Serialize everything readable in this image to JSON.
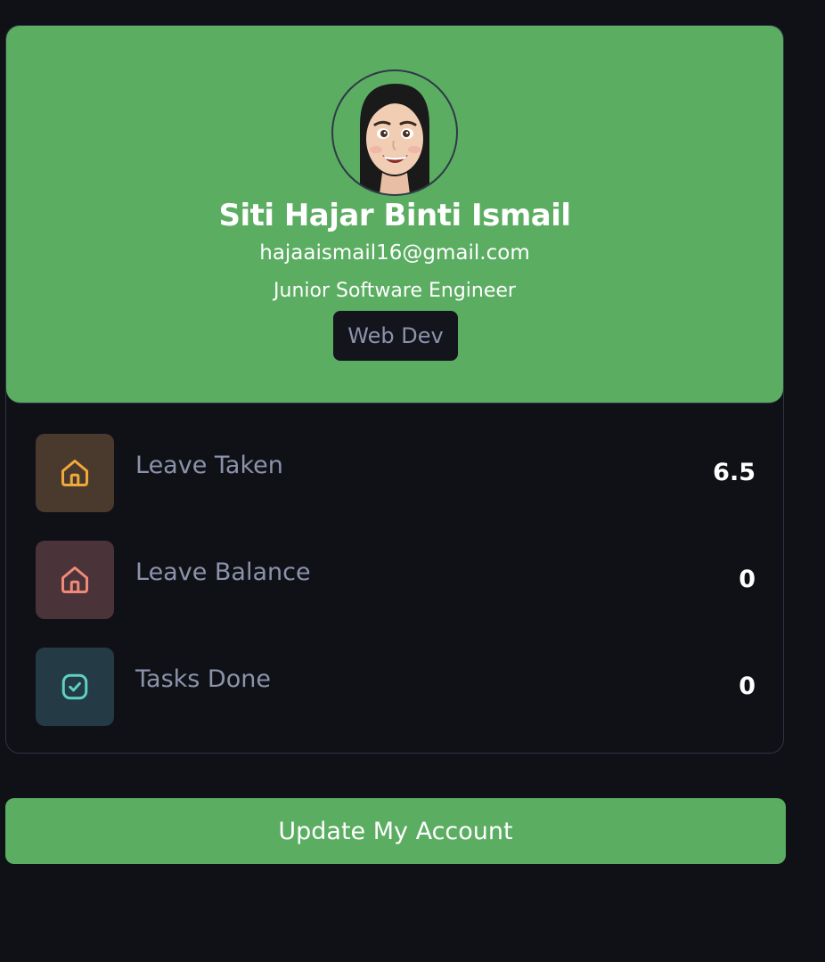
{
  "profile": {
    "name": "Siti Hajar Binti Ismail",
    "email": "hajaaismail16@gmail.com",
    "role": "Junior Software Engineer",
    "department": "Web Dev",
    "avatar_icon": "memoji-avatar"
  },
  "stats": [
    {
      "label": "Leave Taken",
      "value": "6.5",
      "icon": "home-icon",
      "icon_color": "#f2a93b",
      "icon_bg": "#4a3a2e"
    },
    {
      "label": "Leave Balance",
      "value": "0",
      "icon": "home-icon",
      "icon_color": "#ef8a78",
      "icon_bg": "#4a3339"
    },
    {
      "label": "Tasks Done",
      "value": "0",
      "icon": "checkbox-icon",
      "icon_color": "#5fd1c0",
      "icon_bg": "#243a45"
    }
  ],
  "actions": {
    "update_label": "Update My Account"
  },
  "colors": {
    "accent": "#5bad62",
    "background": "#101117",
    "muted_text": "#8b93ab"
  }
}
